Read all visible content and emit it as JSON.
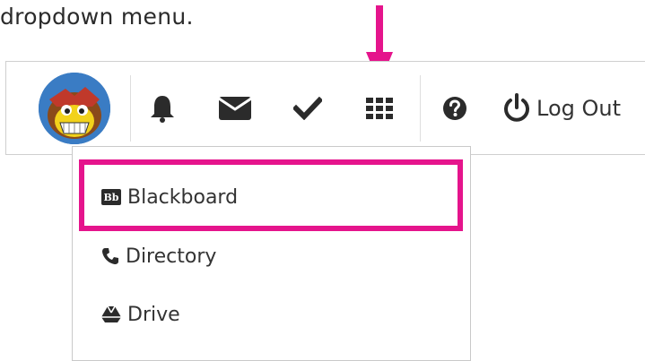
{
  "caption": "dropdown menu.",
  "annotation": {
    "color": "#e5148c"
  },
  "toolbar": {
    "icons": [
      "user-avatar",
      "bell-icon",
      "envelope-icon",
      "check-icon",
      "grid-apps-icon",
      "help-icon",
      "power-icon"
    ],
    "logout_label": "Log Out"
  },
  "dropdown": {
    "items": [
      {
        "label": "Blackboard",
        "icon": "blackboard-icon"
      },
      {
        "label": "Directory",
        "icon": "phone-icon"
      },
      {
        "label": "Drive",
        "icon": "drive-icon"
      }
    ]
  }
}
